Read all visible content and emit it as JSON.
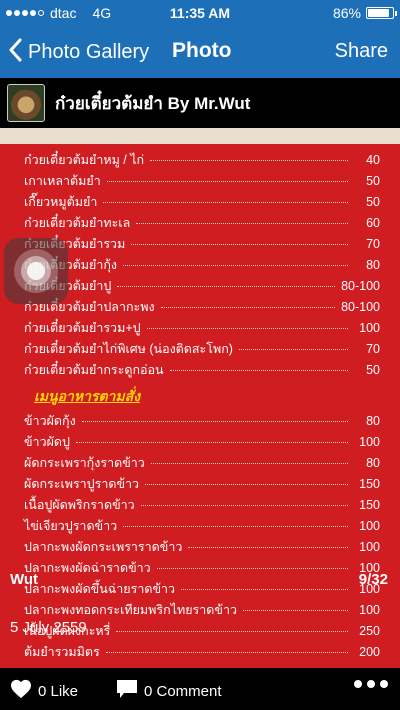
{
  "status_bar": {
    "carrier": "dtac",
    "network": "4G",
    "time": "11:35 AM",
    "battery": "86%",
    "battery_level": 0.86,
    "signal_bars": 4
  },
  "nav": {
    "back_label": "Photo Gallery",
    "title": "Photo",
    "share_label": "Share"
  },
  "album": {
    "name": "ก๋วยเตี๋ยวต้มยำ By Mr.Wut"
  },
  "menu": {
    "items_top": [
      {
        "name": "ก๋วยเตี๋ยวต้มยำหมู / ไก่",
        "price": "40"
      },
      {
        "name": "เกาเหลาต้มยำ",
        "price": "50"
      },
      {
        "name": "เกี๊ยวหมูต้มยำ",
        "price": "50"
      },
      {
        "name": "ก๋วยเตี๋ยวต้มยำทะเล",
        "price": "60"
      },
      {
        "name": "ก๋วยเตี๋ยวต้มยำรวม",
        "price": "70"
      },
      {
        "name": "ก๋วยเตี๋ยวต้มยำกุ้ง",
        "price": "80"
      },
      {
        "name": "ก๋วยเตี๋ยวต้มยำปู",
        "price": "80-100"
      },
      {
        "name": "ก๋วยเตี๋ยวต้มยำปลากะพง",
        "price": "80-100"
      },
      {
        "name": "ก๋วยเตี๋ยวต้มยำรวม+ปู",
        "price": "100"
      },
      {
        "name": "ก๋วยเตี๋ยวต้มยำไก่พิเศษ (น่องติดสะโพก)",
        "price": "70"
      },
      {
        "name": "ก๋วยเตี๋ยวต้มยำกระดูกอ่อน",
        "price": "50"
      }
    ],
    "section_title": "เมนูอาหารตามสั่ง",
    "items_bottom": [
      {
        "name": "ข้าวผัดกุ้ง",
        "price": "80"
      },
      {
        "name": "ข้าวผัดปู",
        "price": "100"
      },
      {
        "name": "ผัดกระเพรากุ้งราดข้าว",
        "price": "80"
      },
      {
        "name": "ผัดกระเพราปูราดข้าว",
        "price": "150"
      },
      {
        "name": "เนื้อปูผัดพริกราดข้าว",
        "price": "150"
      },
      {
        "name": "ไข่เจียวปูราดข้าว",
        "price": "100"
      },
      {
        "name": "ปลากะพงผัดกระเพราราดข้าว",
        "price": "100"
      },
      {
        "name": "ปลากะพงผัดฉ่าราดข้าว",
        "price": "100"
      },
      {
        "name": "ปลากะพงผัดขึ้นฉ่ายราดข้าว",
        "price": "100"
      },
      {
        "name": "ปลากะพงทอดกระเทียมพริกไทยราดข้าว",
        "price": "100"
      },
      {
        "name": "เนื้อปูผัดผงกะหรี่",
        "price": "250"
      },
      {
        "name": "ต้มยำรวมมิตร",
        "price": "200"
      }
    ]
  },
  "caption": {
    "author": "Wut",
    "counter": "9/32",
    "date": "5 July 2559"
  },
  "bottom_bar": {
    "like_label": "0 Like",
    "comment_label": "0 Comment"
  }
}
